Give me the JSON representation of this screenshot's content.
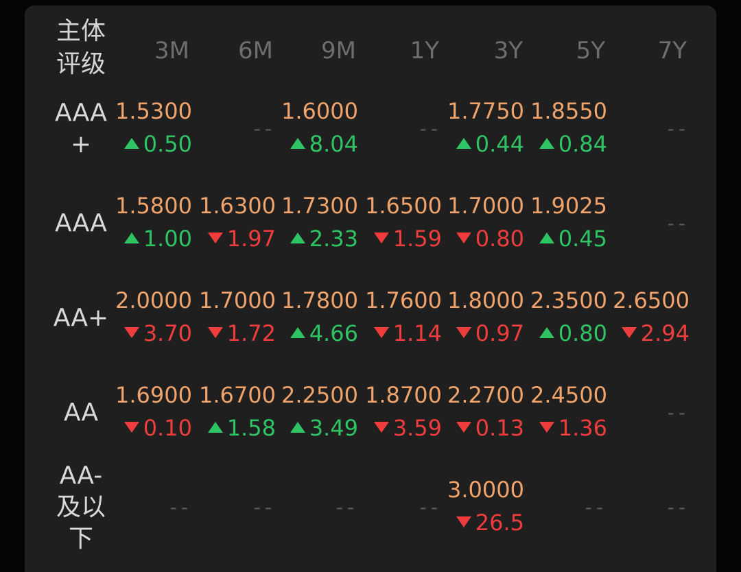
{
  "header": {
    "rating_line1": "主体",
    "rating_line2": "评级",
    "tenors": [
      "3M",
      "6M",
      "9M",
      "1Y",
      "3Y",
      "5Y",
      "7Y"
    ]
  },
  "empty_placeholder": "--",
  "colors": {
    "value": "#f0a36a",
    "up": "#2ec463",
    "down": "#ef3d3d",
    "header": "#6e6e6e",
    "background": "#1f1f1f"
  },
  "rows": [
    {
      "label_lines": [
        "AAA",
        "+"
      ],
      "cells": [
        {
          "value": "1.5300",
          "change": "0.50",
          "dir": "up"
        },
        null,
        {
          "value": "1.6000",
          "change": "8.04",
          "dir": "up"
        },
        null,
        {
          "value": "1.7750",
          "change": "0.44",
          "dir": "up"
        },
        {
          "value": "1.8550",
          "change": "0.84",
          "dir": "up"
        },
        null
      ]
    },
    {
      "label_lines": [
        "AAA"
      ],
      "cells": [
        {
          "value": "1.5800",
          "change": "1.00",
          "dir": "up"
        },
        {
          "value": "1.6300",
          "change": "1.97",
          "dir": "down"
        },
        {
          "value": "1.7300",
          "change": "2.33",
          "dir": "up"
        },
        {
          "value": "1.6500",
          "change": "1.59",
          "dir": "down"
        },
        {
          "value": "1.7000",
          "change": "0.80",
          "dir": "down"
        },
        {
          "value": "1.9025",
          "change": "0.45",
          "dir": "up"
        },
        null
      ]
    },
    {
      "label_lines": [
        "AA+"
      ],
      "cells": [
        {
          "value": "2.0000",
          "change": "3.70",
          "dir": "down"
        },
        {
          "value": "1.7000",
          "change": "1.72",
          "dir": "down"
        },
        {
          "value": "1.7800",
          "change": "4.66",
          "dir": "up"
        },
        {
          "value": "1.7600",
          "change": "1.14",
          "dir": "down"
        },
        {
          "value": "1.8000",
          "change": "0.97",
          "dir": "down"
        },
        {
          "value": "2.3500",
          "change": "0.80",
          "dir": "up"
        },
        {
          "value": "2.6500",
          "change": "2.94",
          "dir": "down"
        }
      ]
    },
    {
      "label_lines": [
        "AA"
      ],
      "cells": [
        {
          "value": "1.6900",
          "change": "0.10",
          "dir": "down"
        },
        {
          "value": "1.6700",
          "change": "1.58",
          "dir": "up"
        },
        {
          "value": "2.2500",
          "change": "3.49",
          "dir": "up"
        },
        {
          "value": "1.8700",
          "change": "3.59",
          "dir": "down"
        },
        {
          "value": "2.2700",
          "change": "0.13",
          "dir": "down"
        },
        {
          "value": "2.4500",
          "change": "1.36",
          "dir": "down"
        },
        null
      ]
    },
    {
      "label_lines": [
        "AA-",
        "及以",
        "下"
      ],
      "cells": [
        null,
        null,
        null,
        null,
        {
          "value": "3.0000",
          "change": "26.5",
          "dir": "down"
        },
        null,
        null
      ]
    }
  ]
}
